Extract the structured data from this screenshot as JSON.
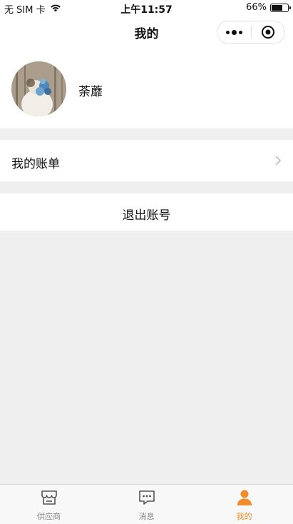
{
  "status_bar": {
    "carrier": "无 SIM 卡",
    "time": "上午11:57",
    "battery_text": "66%",
    "battery_level": 0.66
  },
  "nav": {
    "title": "我的",
    "more_icon": "more-dots-icon",
    "close_icon": "target-close-icon"
  },
  "profile": {
    "username": "荼蘼"
  },
  "menu": {
    "bill_label": "我的账单",
    "logout_label": "退出账号"
  },
  "tabs": [
    {
      "label": "供应商",
      "icon": "store-icon",
      "active": false
    },
    {
      "label": "消息",
      "icon": "message-icon",
      "active": false
    },
    {
      "label": "我的",
      "icon": "user-icon",
      "active": true
    }
  ],
  "colors": {
    "accent": "#f08c2b",
    "background": "#efefef",
    "tab_inactive": "#888888"
  }
}
